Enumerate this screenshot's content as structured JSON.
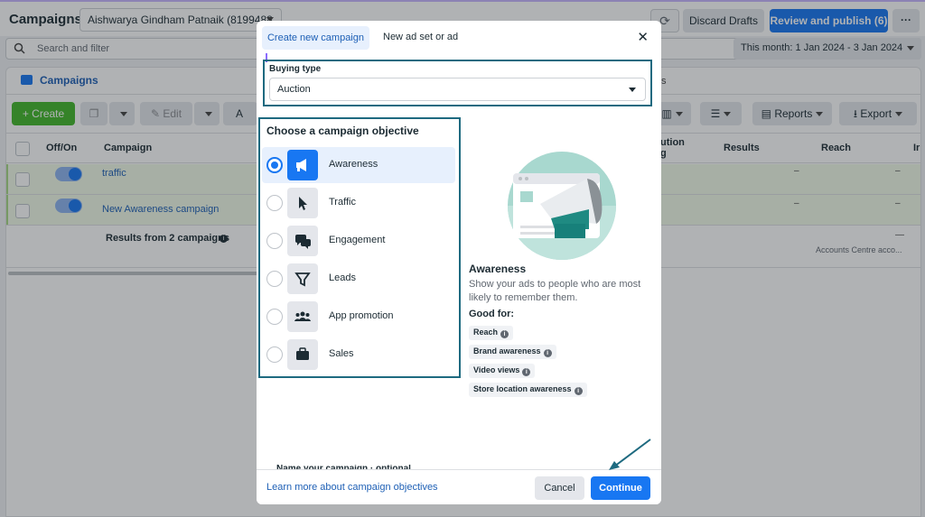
{
  "app": {
    "title": "Campaigns",
    "account_selector": "Aishwarya Gindham Patnaik (8199488...",
    "refresh_glyph": "⟳",
    "discard_label": "Discard Drafts",
    "publish_label": "Review and publish (6)",
    "more_label": "···",
    "search_placeholder": "Search and filter",
    "date_range": "This month: 1 Jan 2024 - 3 Jan 2024"
  },
  "panel": {
    "tab_label": "Campaigns",
    "tab_side_letter": "ts",
    "create_label": "+ Create",
    "edit_label": "Edit",
    "test_label": "A",
    "reports_label": "Reports",
    "export_label": "Export",
    "columns": {
      "offon": "Off/On",
      "campaign": "Campaign",
      "attribution": "ution",
      "attribution2": "g",
      "results": "Results",
      "reach": "Reach",
      "impressions": "Ir"
    },
    "rows": [
      {
        "name": "traffic",
        "results": "–",
        "reach": "–",
        "other": "–"
      },
      {
        "name": "New Awareness campaign",
        "results": "–",
        "reach": "–",
        "other": "–"
      }
    ],
    "summary": {
      "label": "Results from 2 campaigns",
      "reach": "—",
      "reach_note": "Accounts Centre acco..."
    }
  },
  "modal": {
    "tab_active": "Create new campaign",
    "tab_other": "New ad set or ad",
    "close_glyph": "✕",
    "buying_type_label": "Buying type",
    "buying_type_value": "Auction",
    "objective_heading": "Choose a campaign objective",
    "objectives": [
      {
        "label": "Awareness",
        "icon": "megaphone-icon",
        "selected": true
      },
      {
        "label": "Traffic",
        "icon": "cursor-icon",
        "selected": false
      },
      {
        "label": "Engagement",
        "icon": "chat-bubbles-icon",
        "selected": false
      },
      {
        "label": "Leads",
        "icon": "funnel-icon",
        "selected": false
      },
      {
        "label": "App promotion",
        "icon": "people-icon",
        "selected": false
      },
      {
        "label": "Sales",
        "icon": "briefcase-icon",
        "selected": false
      }
    ],
    "detail": {
      "title": "Awareness",
      "description": "Show your ads to people who are most likely to remember them.",
      "good_for_label": "Good for:",
      "chips": [
        "Reach",
        "Brand awareness",
        "Video views",
        "Store location awareness"
      ]
    },
    "name_section_label": "Name your campaign · optional",
    "learn_more": "Learn more about campaign objectives",
    "cancel_label": "Cancel",
    "continue_label": "Continue"
  },
  "colors": {
    "accent": "#1877f2",
    "highlight_box": "#1e6a80",
    "create_green": "#42b72a"
  }
}
